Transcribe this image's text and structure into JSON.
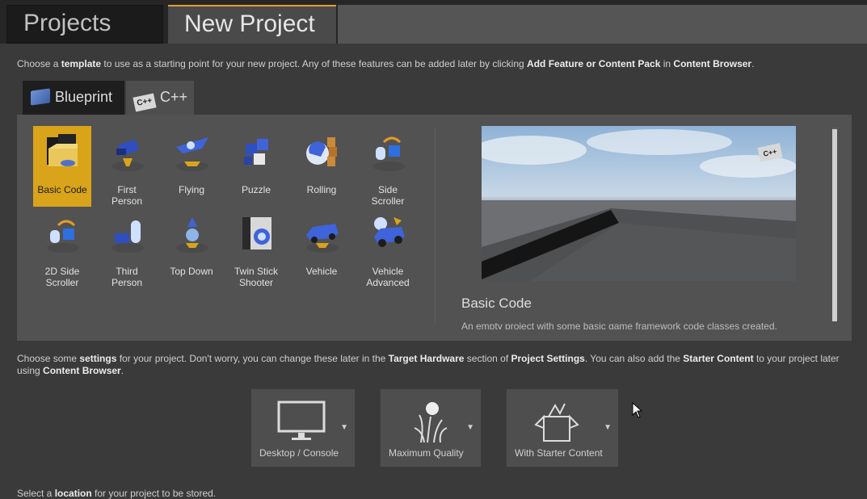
{
  "top_tabs": [
    {
      "label": "Projects",
      "active": false
    },
    {
      "label": "New Project",
      "active": true
    }
  ],
  "template_intro": {
    "p1": "Choose a ",
    "b1": "template",
    "p2": " to use as a starting point for your new project.  Any of these features can be added later by clicking ",
    "b2": "Add Feature or Content Pack",
    "p3": " in ",
    "b3": "Content Browser",
    "p4": "."
  },
  "language_tabs": [
    {
      "label": "Blueprint",
      "icon": "blueprint-book-icon",
      "active": false
    },
    {
      "label": "C++",
      "icon": "cpp-icon",
      "icon_text": "C++",
      "active": true
    }
  ],
  "templates": [
    {
      "label": "Basic Code",
      "icon": "basic-code-folder-icon",
      "selected": true
    },
    {
      "label": "First\nPerson",
      "icon": "first-person-icon",
      "selected": false
    },
    {
      "label": "Flying",
      "icon": "flying-icon",
      "selected": false
    },
    {
      "label": "Puzzle",
      "icon": "puzzle-icon",
      "selected": false
    },
    {
      "label": "Rolling",
      "icon": "rolling-icon",
      "selected": false
    },
    {
      "label": "Side\nScroller",
      "icon": "side-scroller-icon",
      "selected": false
    },
    {
      "label": "2D Side\nScroller",
      "icon": "2d-side-scroller-icon",
      "selected": false
    },
    {
      "label": "Third\nPerson",
      "icon": "third-person-icon",
      "selected": false
    },
    {
      "label": "Top Down",
      "icon": "top-down-icon",
      "selected": false
    },
    {
      "label": "Twin Stick\nShooter",
      "icon": "twin-stick-shooter-icon",
      "selected": false
    },
    {
      "label": "Vehicle",
      "icon": "vehicle-icon",
      "selected": false
    },
    {
      "label": "Vehicle\nAdvanced",
      "icon": "vehicle-advanced-icon",
      "selected": false
    }
  ],
  "preview": {
    "title": "Basic Code",
    "description": "An empty project with some basic game framework code classes created.",
    "badge_text": "C++"
  },
  "settings_intro": {
    "p1": "Choose some ",
    "b1": "settings",
    "p2": " for your project.  Don't worry, you can change these later in the ",
    "b2": "Target Hardware",
    "p3": " section of ",
    "b3": "Project Settings",
    "p4": ".  You can also add the ",
    "b4": "Starter Content",
    "p5": " to your project later",
    "p6": "using ",
    "b5": "Content Browser",
    "p7": "."
  },
  "settings": [
    {
      "label": "Desktop / Console",
      "icon": "monitor-icon"
    },
    {
      "label": "Maximum Quality",
      "icon": "quality-grass-icon"
    },
    {
      "label": "With Starter Content",
      "icon": "starter-content-box-icon"
    }
  ],
  "location_intro": {
    "p1": "Select a ",
    "b1": "location",
    "p2": " for your project to be stored."
  },
  "colors": {
    "accent": "#d9a31a",
    "background": "#3a3a3a",
    "panel": "#525252"
  }
}
